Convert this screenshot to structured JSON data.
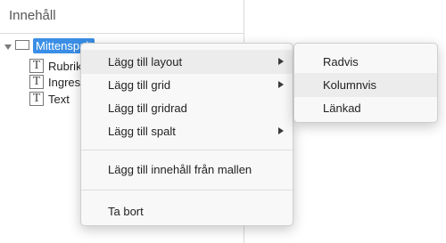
{
  "panel": {
    "title": "Innehåll"
  },
  "tree": {
    "root": {
      "label": "Mittenspalt"
    },
    "children": [
      {
        "label": "Rubrik",
        "icon": "text-icon"
      },
      {
        "label": "Ingress",
        "icon": "text-icon"
      },
      {
        "label": "Text",
        "icon": "text-icon"
      }
    ]
  },
  "context_menu": {
    "items": [
      {
        "label": "Lägg till layout",
        "has_submenu": true
      },
      {
        "label": "Lägg till grid",
        "has_submenu": true
      },
      {
        "label": "Lägg till gridrad",
        "has_submenu": false
      },
      {
        "label": "Lägg till spalt",
        "has_submenu": true
      },
      {
        "label": "Lägg till innehåll från mallen",
        "has_submenu": false
      },
      {
        "label": "Ta bort",
        "has_submenu": false
      }
    ]
  },
  "submenu": {
    "items": [
      {
        "label": "Radvis"
      },
      {
        "label": "Kolumnvis"
      },
      {
        "label": "Länkad"
      }
    ]
  },
  "colors": {
    "selection": "#3a8ee6",
    "menu_bg": "#f8f8f8",
    "menu_highlight": "#ececec"
  }
}
